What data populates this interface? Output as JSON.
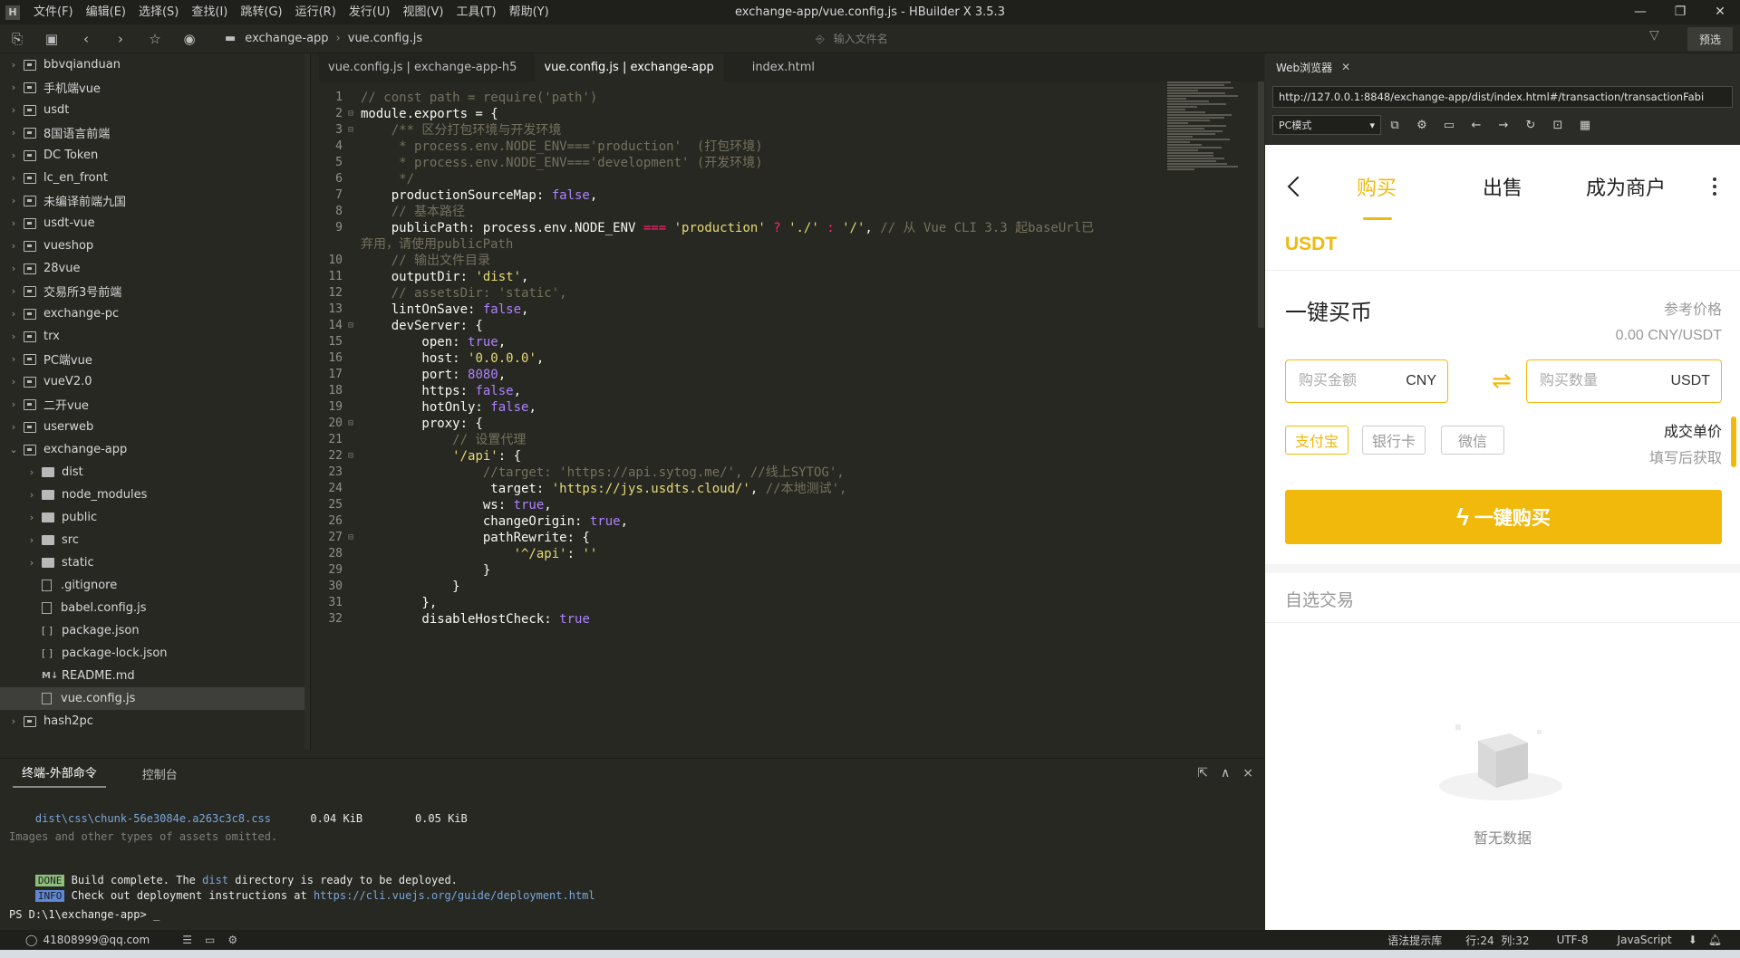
{
  "window": {
    "title": "exchange-app/vue.config.js - HBuilder X 3.5.3",
    "menu": [
      "文件(F)",
      "编辑(E)",
      "选择(S)",
      "查找(I)",
      "跳转(G)",
      "运行(R)",
      "发行(U)",
      "视图(V)",
      "工具(T)",
      "帮助(Y)"
    ],
    "controls": [
      "—",
      "❐",
      "✕"
    ]
  },
  "toolbar": {
    "breadcrumb": [
      "exchange-app",
      "vue.config.js"
    ],
    "file_search_placeholder": "输入文件名",
    "preview_label": "预选"
  },
  "sidebar": {
    "items": [
      {
        "label": "bbvqianduan",
        "type": "project",
        "level": 0,
        "expanded": false
      },
      {
        "label": "手机端vue",
        "type": "project",
        "level": 0,
        "expanded": false
      },
      {
        "label": "usdt",
        "type": "project",
        "level": 0,
        "expanded": false
      },
      {
        "label": "8国语言前端",
        "type": "project",
        "level": 0,
        "expanded": false
      },
      {
        "label": "DC Token",
        "type": "project",
        "level": 0,
        "expanded": false
      },
      {
        "label": "lc_en_front",
        "type": "project",
        "level": 0,
        "expanded": false
      },
      {
        "label": "未编译前端九国",
        "type": "project",
        "level": 0,
        "expanded": false
      },
      {
        "label": "usdt-vue",
        "type": "project",
        "level": 0,
        "expanded": false
      },
      {
        "label": "vueshop",
        "type": "project",
        "level": 0,
        "expanded": false
      },
      {
        "label": "28vue",
        "type": "project",
        "level": 0,
        "expanded": false
      },
      {
        "label": "交易所3号前端",
        "type": "project",
        "level": 0,
        "expanded": false
      },
      {
        "label": "exchange-pc",
        "type": "project",
        "level": 0,
        "expanded": false
      },
      {
        "label": "trx",
        "type": "project",
        "level": 0,
        "expanded": false
      },
      {
        "label": "PC端vue",
        "type": "project",
        "level": 0,
        "expanded": false
      },
      {
        "label": "vueV2.0",
        "type": "project",
        "level": 0,
        "expanded": false
      },
      {
        "label": "二开vue",
        "type": "project",
        "level": 0,
        "expanded": false
      },
      {
        "label": "userweb",
        "type": "project",
        "level": 0,
        "expanded": false
      },
      {
        "label": "exchange-app",
        "type": "project",
        "level": 0,
        "expanded": true
      },
      {
        "label": "dist",
        "type": "folder",
        "level": 1,
        "expanded": false
      },
      {
        "label": "node_modules",
        "type": "folder",
        "level": 1,
        "expanded": false
      },
      {
        "label": "public",
        "type": "folder",
        "level": 1,
        "expanded": false
      },
      {
        "label": "src",
        "type": "folder",
        "level": 1,
        "expanded": false
      },
      {
        "label": "static",
        "type": "folder",
        "level": 1,
        "expanded": false
      },
      {
        "label": ".gitignore",
        "type": "file",
        "level": 1
      },
      {
        "label": "babel.config.js",
        "type": "js",
        "level": 1
      },
      {
        "label": "package.json",
        "type": "json",
        "level": 1
      },
      {
        "label": "package-lock.json",
        "type": "json",
        "level": 1
      },
      {
        "label": "README.md",
        "type": "md",
        "level": 1
      },
      {
        "label": "vue.config.js",
        "type": "js",
        "level": 1,
        "selected": true
      },
      {
        "label": "hash2pc",
        "type": "project",
        "level": 0,
        "expanded": false
      }
    ]
  },
  "tabs": [
    {
      "label": "vue.config.js | exchange-app-h5",
      "active": false
    },
    {
      "label": "vue.config.js | exchange-app",
      "active": true
    },
    {
      "label": "index.html",
      "active": false
    }
  ],
  "code": [
    {
      "n": "1",
      "fold": "",
      "tokens": [
        [
          "c-com",
          "// const path = require('path')"
        ]
      ]
    },
    {
      "n": "2",
      "fold": "⊟",
      "tokens": [
        [
          "",
          "module.exports = {"
        ]
      ]
    },
    {
      "n": "3",
      "fold": "⊟",
      "tokens": [
        [
          "c-com",
          "    /** 区分打包环境与开发环境"
        ]
      ]
    },
    {
      "n": "4",
      "fold": "",
      "tokens": [
        [
          "c-com",
          "     * process.env.NODE_ENV==='production'  (打包环境)"
        ]
      ]
    },
    {
      "n": "5",
      "fold": "",
      "tokens": [
        [
          "c-com",
          "     * process.env.NODE_ENV==='development' (开发环境)"
        ]
      ]
    },
    {
      "n": "6",
      "fold": "",
      "tokens": [
        [
          "c-com",
          "     */"
        ]
      ]
    },
    {
      "n": "7",
      "fold": "",
      "tokens": [
        [
          "",
          "    productionSourceMap: "
        ],
        [
          "c-kw",
          "false"
        ],
        [
          "",
          ","
        ]
      ]
    },
    {
      "n": "8",
      "fold": "",
      "tokens": [
        [
          "c-com",
          "    // 基本路径"
        ]
      ]
    },
    {
      "n": "9",
      "fold": "",
      "tokens": [
        [
          "",
          "    publicPath: process.env.NODE_ENV "
        ],
        [
          "c-op",
          "==="
        ],
        [
          "",
          " "
        ],
        [
          "c-str",
          "'production'"
        ],
        [
          "",
          " "
        ],
        [
          "c-op",
          "?"
        ],
        [
          "",
          " "
        ],
        [
          "c-str",
          "'./'"
        ],
        [
          "",
          " "
        ],
        [
          "c-op",
          ":"
        ],
        [
          "",
          " "
        ],
        [
          "c-str",
          "'/'"
        ],
        [
          "",
          ", "
        ],
        [
          "c-com",
          "// 从 Vue CLI 3.3 起baseUrl已"
        ]
      ]
    },
    {
      "n": "",
      "fold": "",
      "tokens": [
        [
          "c-com",
          "弃用，请使用publicPath"
        ]
      ],
      "wrap": true
    },
    {
      "n": "10",
      "fold": "",
      "tokens": [
        [
          "c-com",
          "    // 输出文件目录"
        ]
      ]
    },
    {
      "n": "11",
      "fold": "",
      "tokens": [
        [
          "",
          "    outputDir: "
        ],
        [
          "c-str",
          "'dist'"
        ],
        [
          "",
          ","
        ]
      ]
    },
    {
      "n": "12",
      "fold": "",
      "tokens": [
        [
          "c-com",
          "    // assetsDir: 'static',"
        ]
      ]
    },
    {
      "n": "13",
      "fold": "",
      "tokens": [
        [
          "",
          "    lintOnSave: "
        ],
        [
          "c-kw",
          "false"
        ],
        [
          "",
          ","
        ]
      ]
    },
    {
      "n": "14",
      "fold": "⊟",
      "tokens": [
        [
          "",
          "    devServer: {"
        ]
      ]
    },
    {
      "n": "15",
      "fold": "",
      "tokens": [
        [
          "",
          "        open: "
        ],
        [
          "c-kw",
          "true"
        ],
        [
          "",
          ","
        ]
      ]
    },
    {
      "n": "16",
      "fold": "",
      "tokens": [
        [
          "",
          "        host: "
        ],
        [
          "c-str",
          "'0.0.0.0'"
        ],
        [
          "",
          ","
        ]
      ]
    },
    {
      "n": "17",
      "fold": "",
      "tokens": [
        [
          "",
          "        port: "
        ],
        [
          "c-kw",
          "8080"
        ],
        [
          "",
          ","
        ]
      ]
    },
    {
      "n": "18",
      "fold": "",
      "tokens": [
        [
          "",
          "        https: "
        ],
        [
          "c-kw",
          "false"
        ],
        [
          "",
          ","
        ]
      ]
    },
    {
      "n": "19",
      "fold": "",
      "tokens": [
        [
          "",
          "        hotOnly: "
        ],
        [
          "c-kw",
          "false"
        ],
        [
          "",
          ","
        ]
      ]
    },
    {
      "n": "20",
      "fold": "⊟",
      "tokens": [
        [
          "",
          "        proxy: {"
        ]
      ]
    },
    {
      "n": "21",
      "fold": "",
      "tokens": [
        [
          "c-com",
          "            // 设置代理"
        ]
      ]
    },
    {
      "n": "22",
      "fold": "⊟",
      "tokens": [
        [
          "",
          "            "
        ],
        [
          "c-str",
          "'/api'"
        ],
        [
          "",
          ": {"
        ]
      ]
    },
    {
      "n": "23",
      "fold": "",
      "tokens": [
        [
          "c-com",
          "                //target: 'https://api.sytog.me/', //线上SYTOG',"
        ]
      ]
    },
    {
      "n": "24",
      "fold": "",
      "tokens": [
        [
          "",
          "                 target: "
        ],
        [
          "c-str",
          "'https://jys.usdts.cloud/'"
        ],
        [
          "",
          ", "
        ],
        [
          "c-com",
          "//本地测试',"
        ]
      ]
    },
    {
      "n": "25",
      "fold": "",
      "tokens": [
        [
          "",
          "                ws: "
        ],
        [
          "c-kw",
          "true"
        ],
        [
          "",
          ","
        ]
      ]
    },
    {
      "n": "26",
      "fold": "",
      "tokens": [
        [
          "",
          "                changeOrigin: "
        ],
        [
          "c-kw",
          "true"
        ],
        [
          "",
          ","
        ]
      ]
    },
    {
      "n": "27",
      "fold": "⊟",
      "tokens": [
        [
          "",
          "                pathRewrite: {"
        ]
      ]
    },
    {
      "n": "28",
      "fold": "",
      "tokens": [
        [
          "",
          "                    "
        ],
        [
          "c-str",
          "'^/api'"
        ],
        [
          "",
          ": "
        ],
        [
          "c-str",
          "''"
        ]
      ]
    },
    {
      "n": "29",
      "fold": "",
      "tokens": [
        [
          "",
          "                }"
        ]
      ]
    },
    {
      "n": "30",
      "fold": "",
      "tokens": [
        [
          "",
          "            }"
        ]
      ]
    },
    {
      "n": "31",
      "fold": "",
      "tokens": [
        [
          "",
          "        },"
        ]
      ]
    },
    {
      "n": "32",
      "fold": "",
      "tokens": [
        [
          "",
          "        disableHostCheck: "
        ],
        [
          "c-kw",
          "true"
        ]
      ]
    }
  ],
  "bottom": {
    "tabs": [
      {
        "label": "终端-外部命令",
        "active": true
      },
      {
        "label": "控制台",
        "active": false
      }
    ],
    "terminal": {
      "asset_file": "dist\\css\\chunk-56e3084e.a263c3c8.css",
      "asset_size": "0.04 KiB",
      "asset_gzip": "0.05 KiB",
      "omitted": "Images and other types of assets omitted.",
      "done_badge": "DONE",
      "done_text_1": "Build complete. The ",
      "done_dist": "dist",
      "done_text_2": " directory is ready to be deployed.",
      "info_badge": "INFO",
      "info_text": "Check out deployment instructions at ",
      "info_url": "https://cli.vuejs.org/guide/deployment.html",
      "prompt": "PS D:\\1\\exchange-app> _"
    }
  },
  "statusbar": {
    "user": "41808999@qq.com",
    "hint_lib": "语法提示库",
    "position": "行:24  列:32",
    "encoding": "UTF-8",
    "language": "JavaScript"
  },
  "browser": {
    "tab_label": "Web浏览器",
    "url": "http://127.0.0.1:8848/exchange-app/dist/index.html#/transaction/transactionFabi",
    "mode": "PC模式"
  },
  "mobile": {
    "tabs": [
      "购买",
      "出售",
      "成为商户"
    ],
    "coin": "USDT",
    "quick_buy_title": "一键买币",
    "ref_price_label": "参考价格",
    "ref_price_value": "0.00 CNY/USDT",
    "amount_placeholder": "购买金额",
    "amount_unit": "CNY",
    "qty_placeholder": "购买数量",
    "qty_unit": "USDT",
    "pay_methods": [
      "支付宝",
      "银行卡",
      "微信"
    ],
    "unit_price_label": "成交单价",
    "unit_price_hint": "填写后获取",
    "buy_button": "一键购买",
    "self_trade_title": "自选交易",
    "empty_text": "暂无数据",
    "accent_color": "#f0b90b"
  }
}
